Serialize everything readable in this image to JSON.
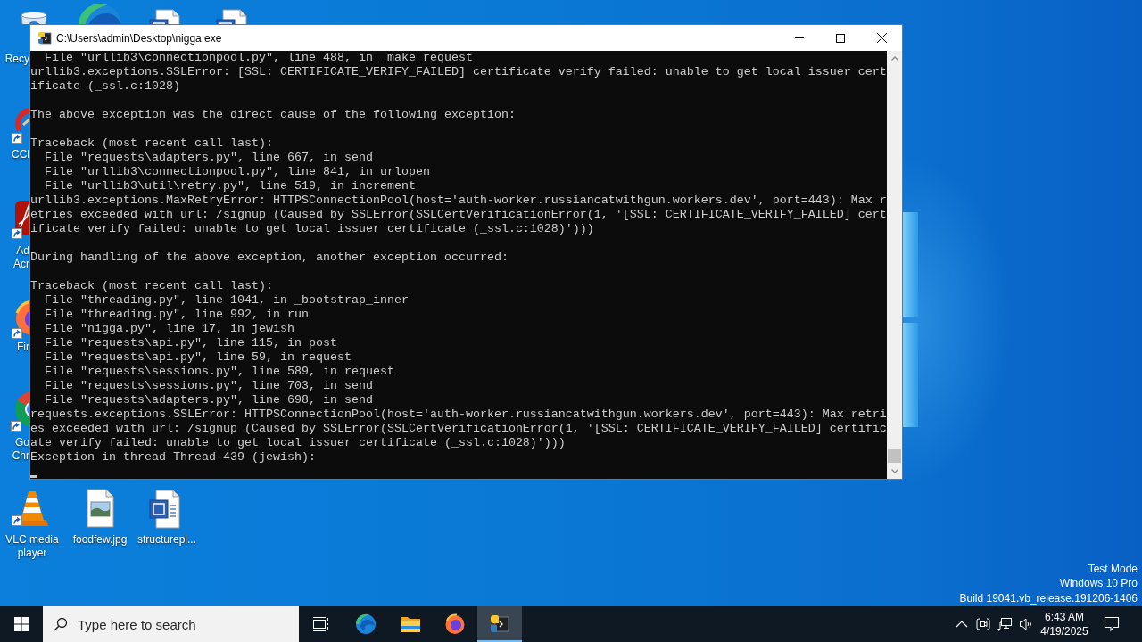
{
  "desktop": {
    "icons": [
      {
        "kind": "recycle_bin",
        "label": "Recy"
      },
      {
        "kind": "edge"
      },
      {
        "kind": "word"
      },
      {
        "kind": "word"
      },
      {
        "kind": "ccleaner",
        "label": "CCl"
      },
      {
        "kind": "acrobat",
        "label": "Ad Acr"
      },
      {
        "kind": "firefox",
        "label": "Fir"
      },
      {
        "kind": "chrome",
        "label": "Go Chr"
      },
      {
        "kind": "vlc",
        "label": "VLC media player"
      },
      {
        "kind": "image",
        "label": "foodfew.jpg"
      },
      {
        "kind": "word",
        "label": "structurepl..."
      }
    ],
    "notice": [
      "Test Mode",
      "Windows 10 Pro",
      "Build 19041.vb_release.191206-1406"
    ]
  },
  "window": {
    "title": "C:\\Users\\admin\\Desktop\\nigga.exe",
    "console": {
      "blocks": [
        {
          "lines": [
            "  File \"urllib3\\connectionpool.py\", line 488, in _make_request",
            "urllib3.exceptions.SSLError: [SSL: CERTIFICATE_VERIFY_FAILED] certificate verify failed: unable to get local issuer cert",
            "ificate (_ssl.c:1028)"
          ]
        },
        {
          "lines": [
            "The above exception was the direct cause of the following exception:"
          ]
        },
        {
          "lines": [
            "Traceback (most recent call last):",
            "  File \"requests\\adapters.py\", line 667, in send",
            "  File \"urllib3\\connectionpool.py\", line 841, in urlopen",
            "  File \"urllib3\\util\\retry.py\", line 519, in increment",
            "urllib3.exceptions.MaxRetryError: HTTPSConnectionPool(host='auth-worker.russiancatwithgun.workers.dev', port=443): Max r",
            "etries exceeded with url: /signup (Caused by SSLError(SSLCertVerificationError(1, '[SSL: CERTIFICATE_VERIFY_FAILED] cert",
            "ificate verify failed: unable to get local issuer certificate (_ssl.c:1028)')))"
          ]
        },
        {
          "lines": [
            "During handling of the above exception, another exception occurred:"
          ]
        },
        {
          "lines": [
            "Traceback (most recent call last):",
            "  File \"threading.py\", line 1041, in _bootstrap_inner",
            "  File \"threading.py\", line 992, in run",
            "  File \"nigga.py\", line 17, in jewish",
            "  File \"requests\\api.py\", line 115, in post",
            "  File \"requests\\api.py\", line 59, in request",
            "  File \"requests\\sessions.py\", line 589, in request",
            "  File \"requests\\sessions.py\", line 703, in send",
            "  File \"requests\\adapters.py\", line 698, in send",
            "requests.exceptions.SSLError: HTTPSConnectionPool(host='auth-worker.russiancatwithgun.workers.dev', port=443): Max retri",
            "es exceeded with url: /signup (Caused by SSLError(SSLCertVerificationError(1, '[SSL: CERTIFICATE_VERIFY_FAILED] certific",
            "ate verify failed: unable to get local issuer certificate (_ssl.c:1028)')))",
            "Exception in thread Thread-439 (jewish):"
          ]
        }
      ]
    }
  },
  "taskbar": {
    "search": {
      "placeholder": "Type here to search"
    },
    "apps": [
      {
        "kind": "edge",
        "selected": false
      },
      {
        "kind": "explorer",
        "selected": false
      },
      {
        "kind": "firefox",
        "selected": false
      },
      {
        "kind": "console",
        "selected": true
      }
    ],
    "tray": {
      "icons": [
        {
          "kind": "chevron"
        },
        {
          "kind": "meet"
        },
        {
          "kind": "network"
        },
        {
          "kind": "volume"
        }
      ],
      "time": "6:43 AM",
      "date": "4/19/2025"
    }
  }
}
